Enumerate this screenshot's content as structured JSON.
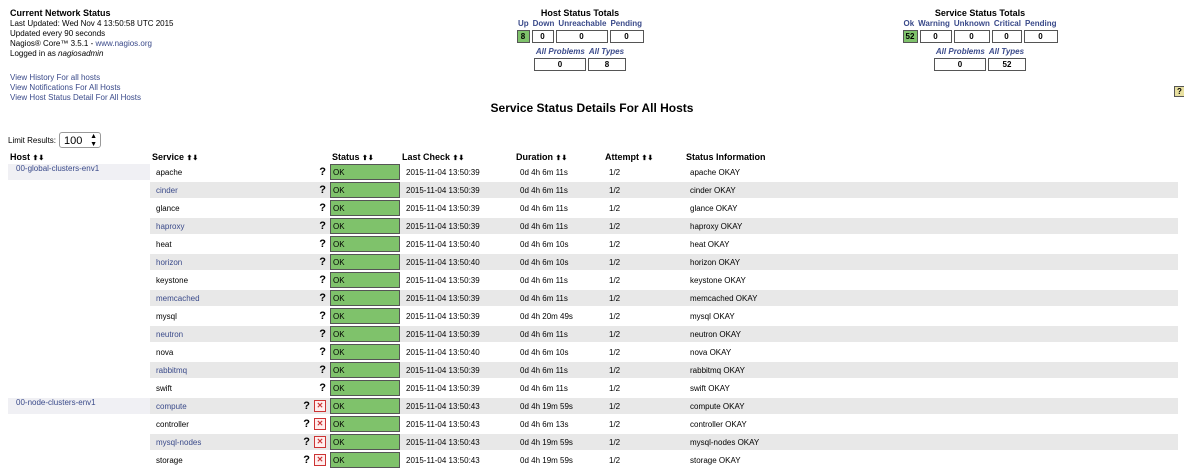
{
  "info": {
    "title": "Current Network Status",
    "last_updated": "Last Updated: Wed Nov 4 13:50:58 UTC 2015",
    "update_interval": "Updated every 90 seconds",
    "core_prefix": "Nagios® Core™ 3.5.1 - ",
    "core_link": "www.nagios.org",
    "logged_in_prefix": "Logged in as ",
    "logged_in_user": "nagiosadmin",
    "links": [
      "View History For all hosts",
      "View Notifications For All Hosts",
      "View Host Status Detail For All Hosts"
    ]
  },
  "host_totals": {
    "title": "Host Status Totals",
    "labels": [
      "Up",
      "Down",
      "Unreachable",
      "Pending"
    ],
    "values": [
      "8",
      "0",
      "0",
      "0"
    ],
    "sub_labels": [
      "All Problems",
      "All Types"
    ],
    "sub_values": [
      "0",
      "8"
    ]
  },
  "service_totals": {
    "title": "Service Status Totals",
    "labels": [
      "Ok",
      "Warning",
      "Unknown",
      "Critical",
      "Pending"
    ],
    "values": [
      "52",
      "0",
      "0",
      "0",
      "0"
    ],
    "sub_labels": [
      "All Problems",
      "All Types"
    ],
    "sub_values": [
      "0",
      "52"
    ]
  },
  "page_title": "Service Status Details For All Hosts",
  "help_icon": "?",
  "limit": {
    "label": "Limit Results:",
    "value": "100"
  },
  "columns": [
    "Host",
    "Service",
    "Status",
    "Last Check",
    "Duration",
    "Attempt",
    "Status Information"
  ],
  "sort_glyph": "⬆⬇",
  "colors": {
    "ok": "#7fc26b",
    "link": "#3a4a8a",
    "row_alt": "#e8e8e8"
  },
  "rows": [
    {
      "host": "00-global-clusters-env1",
      "service": "apache",
      "status": "OK",
      "last_check": "2015-11-04 13:50:39",
      "duration": "0d 4h 6m 11s",
      "attempt": "1/2",
      "info": "apache OKAY",
      "x": false
    },
    {
      "host": "",
      "service": "cinder",
      "status": "OK",
      "last_check": "2015-11-04 13:50:39",
      "duration": "0d 4h 6m 11s",
      "attempt": "1/2",
      "info": "cinder OKAY",
      "x": false
    },
    {
      "host": "",
      "service": "glance",
      "status": "OK",
      "last_check": "2015-11-04 13:50:39",
      "duration": "0d 4h 6m 11s",
      "attempt": "1/2",
      "info": "glance OKAY",
      "x": false
    },
    {
      "host": "",
      "service": "haproxy",
      "status": "OK",
      "last_check": "2015-11-04 13:50:39",
      "duration": "0d 4h 6m 11s",
      "attempt": "1/2",
      "info": "haproxy OKAY",
      "x": false
    },
    {
      "host": "",
      "service": "heat",
      "status": "OK",
      "last_check": "2015-11-04 13:50:40",
      "duration": "0d 4h 6m 10s",
      "attempt": "1/2",
      "info": "heat OKAY",
      "x": false
    },
    {
      "host": "",
      "service": "horizon",
      "status": "OK",
      "last_check": "2015-11-04 13:50:40",
      "duration": "0d 4h 6m 10s",
      "attempt": "1/2",
      "info": "horizon OKAY",
      "x": false
    },
    {
      "host": "",
      "service": "keystone",
      "status": "OK",
      "last_check": "2015-11-04 13:50:39",
      "duration": "0d 4h 6m 11s",
      "attempt": "1/2",
      "info": "keystone OKAY",
      "x": false
    },
    {
      "host": "",
      "service": "memcached",
      "status": "OK",
      "last_check": "2015-11-04 13:50:39",
      "duration": "0d 4h 6m 11s",
      "attempt": "1/2",
      "info": "memcached OKAY",
      "x": false
    },
    {
      "host": "",
      "service": "mysql",
      "status": "OK",
      "last_check": "2015-11-04 13:50:39",
      "duration": "0d 4h 20m 49s",
      "attempt": "1/2",
      "info": "mysql OKAY",
      "x": false
    },
    {
      "host": "",
      "service": "neutron",
      "status": "OK",
      "last_check": "2015-11-04 13:50:39",
      "duration": "0d 4h 6m 11s",
      "attempt": "1/2",
      "info": "neutron OKAY",
      "x": false
    },
    {
      "host": "",
      "service": "nova",
      "status": "OK",
      "last_check": "2015-11-04 13:50:40",
      "duration": "0d 4h 6m 10s",
      "attempt": "1/2",
      "info": "nova OKAY",
      "x": false
    },
    {
      "host": "",
      "service": "rabbitmq",
      "status": "OK",
      "last_check": "2015-11-04 13:50:39",
      "duration": "0d 4h 6m 11s",
      "attempt": "1/2",
      "info": "rabbitmq OKAY",
      "x": false
    },
    {
      "host": "",
      "service": "swift",
      "status": "OK",
      "last_check": "2015-11-04 13:50:39",
      "duration": "0d 4h 6m 11s",
      "attempt": "1/2",
      "info": "swift OKAY",
      "x": false
    },
    {
      "host": "00-node-clusters-env1",
      "service": "compute",
      "status": "OK",
      "last_check": "2015-11-04 13:50:43",
      "duration": "0d 4h 19m 59s",
      "attempt": "1/2",
      "info": "compute OKAY",
      "x": true
    },
    {
      "host": "",
      "service": "controller",
      "status": "OK",
      "last_check": "2015-11-04 13:50:43",
      "duration": "0d 4h 6m 13s",
      "attempt": "1/2",
      "info": "controller OKAY",
      "x": true
    },
    {
      "host": "",
      "service": "mysql-nodes",
      "status": "OK",
      "last_check": "2015-11-04 13:50:43",
      "duration": "0d 4h 19m 59s",
      "attempt": "1/2",
      "info": "mysql-nodes OKAY",
      "x": true
    },
    {
      "host": "",
      "service": "storage",
      "status": "OK",
      "last_check": "2015-11-04 13:50:43",
      "duration": "0d 4h 19m 59s",
      "attempt": "1/2",
      "info": "storage OKAY",
      "x": true
    }
  ]
}
